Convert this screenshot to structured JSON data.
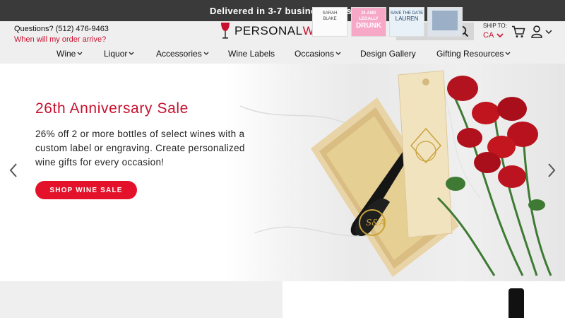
{
  "announcement": "Delivered in 3-7 business days!",
  "contact": {
    "phone": "Questions? (512) 476-9463",
    "order_link": "When will my order arrive?"
  },
  "logo": {
    "part1": "PERSONAL",
    "part2": "WINE"
  },
  "search": {
    "placeholder": "",
    "value": ""
  },
  "ship_to": {
    "label": "SHIP TO:",
    "country": "CA"
  },
  "nav": [
    {
      "label": "Wine",
      "dropdown": true
    },
    {
      "label": "Liquor",
      "dropdown": true
    },
    {
      "label": "Accessories",
      "dropdown": true
    },
    {
      "label": "Wine Labels",
      "dropdown": false
    },
    {
      "label": "Occasions",
      "dropdown": true
    },
    {
      "label": "Design Gallery",
      "dropdown": false
    },
    {
      "label": "Gifting Resources",
      "dropdown": true
    }
  ],
  "hero": {
    "title": "26th Anniversary Sale",
    "body": "26% off 2 or more bottles of select wines with a custom label or engraving. Create personalized wine gifts for every occasion!",
    "cta": "SHOP WINE SALE",
    "engraving": "S&A"
  },
  "thumbnails": [
    {
      "line1": "SARAH",
      "line2": "BLAKE"
    },
    {
      "line1": "21 AND LEGALLY",
      "line2": "DRUNK"
    },
    {
      "line1": "SAVE THE DATE",
      "line2": "LAUREN"
    },
    {
      "line1": "",
      "line2": ""
    }
  ],
  "colors": {
    "brand_red": "#c8102e",
    "cta_red": "#e3112a",
    "topbar": "#3a3a3a",
    "header_bg": "#efefef"
  },
  "icons": [
    "wine-glass-logo-icon",
    "search-icon",
    "chevron-down-icon",
    "cart-icon",
    "user-icon",
    "chevron-left-icon",
    "chevron-right-icon"
  ]
}
